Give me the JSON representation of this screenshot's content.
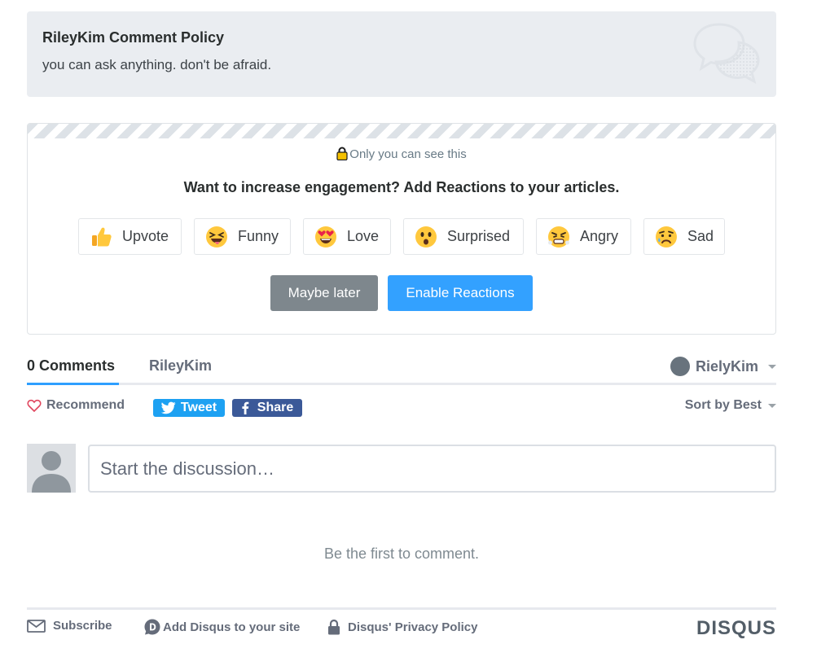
{
  "policy": {
    "title": "RileyKim Comment Policy",
    "text": "you can ask anything. don't be afraid.",
    "icon": "speech-bubbles-icon"
  },
  "promo": {
    "private_note": "Only you can see this",
    "heading": "Want to increase engagement? Add Reactions to your articles.",
    "reactions": [
      {
        "label": "Upvote",
        "icon": "thumbs-up-icon"
      },
      {
        "label": "Funny",
        "icon": "laughing-face-icon"
      },
      {
        "label": "Love",
        "icon": "heart-eyes-face-icon"
      },
      {
        "label": "Surprised",
        "icon": "surprised-face-icon"
      },
      {
        "label": "Angry",
        "icon": "angry-face-icon"
      },
      {
        "label": "Sad",
        "icon": "sad-face-icon"
      }
    ],
    "maybe_later_label": "Maybe later",
    "enable_label": "Enable Reactions"
  },
  "nav": {
    "comments_tab": "0 Comments",
    "community_tab": "RileyKim",
    "user_name": "RielyKim"
  },
  "actions": {
    "recommend_label": "Recommend",
    "tweet_label": "Tweet",
    "share_label": "Share",
    "sort_label": "Sort by Best"
  },
  "composer": {
    "placeholder": "Start the discussion…"
  },
  "empty_state": "Be the first to comment.",
  "footer": {
    "subscribe_label": "Subscribe",
    "add_disqus_label": "Add Disqus to your site",
    "privacy_label": "Disqus' Privacy Policy",
    "logo_text": "DISQUS"
  },
  "colors": {
    "accent_blue": "#33a1ff",
    "twitter_blue": "#1da1f2",
    "facebook_blue": "#3b5998",
    "muted_button": "#7e878d"
  }
}
